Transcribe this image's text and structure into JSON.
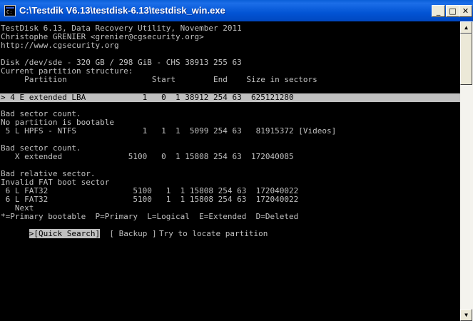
{
  "window": {
    "title": "C:\\Testdik V6.13\\testdisk-6.13\\testdisk_win.exe",
    "minimize_glyph": "_",
    "maximize_glyph": "□",
    "close_glyph": "✕",
    "icon": "console-icon"
  },
  "console": {
    "header": [
      "TestDisk 6.13, Data Recovery Utility, November 2011",
      "Christophe GRENIER <grenier@cgsecurity.org>",
      "http://www.cgsecurity.org"
    ],
    "disk_line": "Disk /dev/sde - 320 GB / 298 GiB - CHS 38913 255 63",
    "structure_label": "Current partition structure:",
    "column_header": "     Partition                  Start        End    Size in sectors",
    "selected_partition": "> 4 E extended LBA            1   0  1 38912 254 63  625121280",
    "groups": [
      {
        "messages": [
          "Bad sector count.",
          "No partition is bootable"
        ],
        "partitions": [
          " 5 L HPFS - NTFS              1   1  1  5099 254 63   81915372 [Videos]"
        ]
      },
      {
        "messages": [
          "Bad sector count."
        ],
        "partitions": [
          "   X extended              5100   0  1 15808 254 63  172040085"
        ]
      },
      {
        "messages": [
          "Bad relative sector.",
          "Invalid FAT boot sector"
        ],
        "partitions": [
          " 6 L FAT32                  5100   1  1 15808 254 63  172040022",
          " 6 L FAT32                  5100   1  1 15808 254 63  172040022"
        ]
      }
    ],
    "next": "   Next",
    "legend": "*=Primary bootable  P=Primary  L=Logical  E=Extended  D=Deleted",
    "menu": {
      "quick_search": ">[Quick Search]",
      "backup": "[ Backup ]"
    },
    "hint": "Try to locate partition"
  },
  "colors": {
    "title_bar": "#0254d4",
    "console_bg": "#000000",
    "console_text": "#c0c0c0",
    "selection_bg": "#c0c0c0"
  }
}
